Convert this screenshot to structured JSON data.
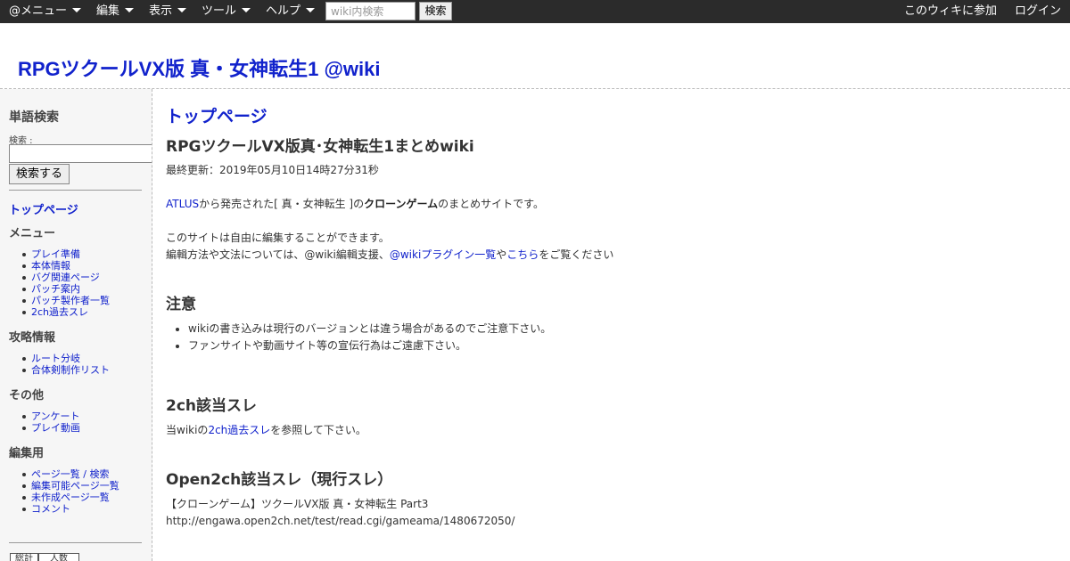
{
  "topbar": {
    "menus": [
      "@メニュー",
      "編集",
      "表示",
      "ツール",
      "ヘルプ"
    ],
    "search_placeholder": "wiki内検索",
    "search_button": "検索",
    "join_label": "このウィキに参加",
    "login_label": "ログイン"
  },
  "header": {
    "site_title": "RPGツクールVX版 真・女神転生1 @wiki"
  },
  "sidebar": {
    "search_heading": "単語検索",
    "search_label": "検索 :",
    "search_button": "検索する",
    "top_link": "トップページ",
    "sections": [
      {
        "title": "メニュー",
        "items": [
          "プレイ準備",
          "本体情報",
          "バグ関連ページ",
          "パッチ案内",
          "パッチ製作者一覧",
          "2ch過去スレ"
        ]
      },
      {
        "title": "攻略情報",
        "items": [
          "ルート分岐",
          "合体剣制作リスト"
        ]
      },
      {
        "title": "その他",
        "items": [
          "アンケート",
          "プレイ動画"
        ]
      },
      {
        "title": "編集用",
        "items": [
          "ページ一覧 / 検索",
          "編集可能ページ一覧",
          "未作成ページ一覧",
          "コメント"
        ]
      }
    ],
    "bottom_tabs": [
      "総計",
      "人数"
    ]
  },
  "main": {
    "page_title": "トップページ",
    "subtitle": "RPGツクールVX版真･女神転生1まとめwiki",
    "last_updated": "最終更新：2019年05月10日14時27分31秒",
    "intro": {
      "link_atlus": "ATLUS",
      "text_1": "から発売された[ 真・女神転生 ]の",
      "bold_clone": "クローンゲーム",
      "text_2": "のまとめサイトです。"
    },
    "edit_note": {
      "line1": "このサイトは自由に編集することができます。",
      "text_1": "編輯方法や文法については、@wiki編輯支援、",
      "link_plugins": "@wikiプラグイン一覧",
      "text_2": "や",
      "link_here": "こちら",
      "text_3": "をご覧ください"
    },
    "caution_heading": "注意",
    "caution_items": [
      "wikiの書き込みは現行のバージョンとは違う場合があるのでご注意下さい。",
      "ファンサイトや動画サイト等の宣伝行為はご遠慮下さい。"
    ],
    "ch2_heading": "2ch該当スレ",
    "ch2_text": {
      "text_1": "当wikiの",
      "link": "2ch過去スレ",
      "text_2": "を参照して下さい。"
    },
    "open2ch_heading": "Open2ch該当スレ（現行スレ）",
    "open2ch_thread": "【クローンゲーム】ツクールVX版 真・女神転生 Part3",
    "open2ch_url": "http://engawa.open2ch.net/test/read.cgi/gameama/1480672050/"
  }
}
